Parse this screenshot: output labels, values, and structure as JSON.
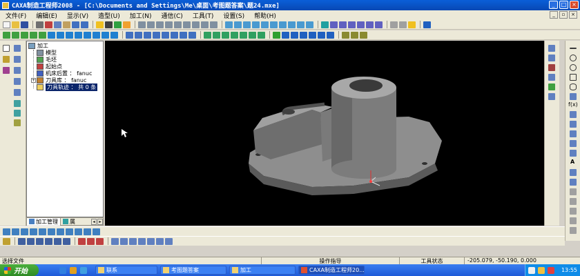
{
  "window": {
    "title": "CAXA制造工程师2008  - [C:\\Documents and Settings\\Me\\桌面\\考图题答案\\题24.mxe]"
  },
  "menu": [
    "文件(F)",
    "编辑(E)",
    "显示(V)",
    "造型(U)",
    "加工(N)",
    "通信(C)",
    "工具(T)",
    "设置(S)",
    "帮助(H)"
  ],
  "tree": {
    "root": "加工",
    "items": [
      {
        "label": "模型",
        "icon": "model-icon"
      },
      {
        "label": "毛坯",
        "icon": "blank-icon"
      },
      {
        "label": "起始点",
        "icon": "start-point-icon"
      },
      {
        "label": "机床后置 ： fanuc",
        "icon": "machine-post-icon"
      },
      {
        "label": "刀具库 ： fanuc",
        "icon": "tool-library-icon"
      },
      {
        "label": "刀具轨迹 ： 共 0 条",
        "icon": "toolpath-folder-icon"
      }
    ],
    "tabs": [
      {
        "label": "加工管理",
        "icon": "process-manager-icon"
      },
      {
        "label": "属",
        "icon": "properties-icon"
      }
    ]
  },
  "status": {
    "left": "选择文件",
    "center": "操作指导",
    "tool_state": "工具状态",
    "coords": "-205.079, -50.190, 0.000"
  },
  "taskbar": {
    "start": "开始",
    "tasks": [
      {
        "label": "联系",
        "active": false
      },
      {
        "label": "考图题答案",
        "active": false
      },
      {
        "label": "加工",
        "active": false
      },
      {
        "label": "CAXA制造工程师20...",
        "active": true
      }
    ],
    "clock": "13:55"
  },
  "right_panel": {
    "fx_label": "f(x)",
    "a_label": "A"
  },
  "colors": {
    "title_bar": "#0848b4",
    "viewport_bg": "#000000",
    "part_gray": "#8a8a8a",
    "taskbar": "#1e5ad8"
  }
}
